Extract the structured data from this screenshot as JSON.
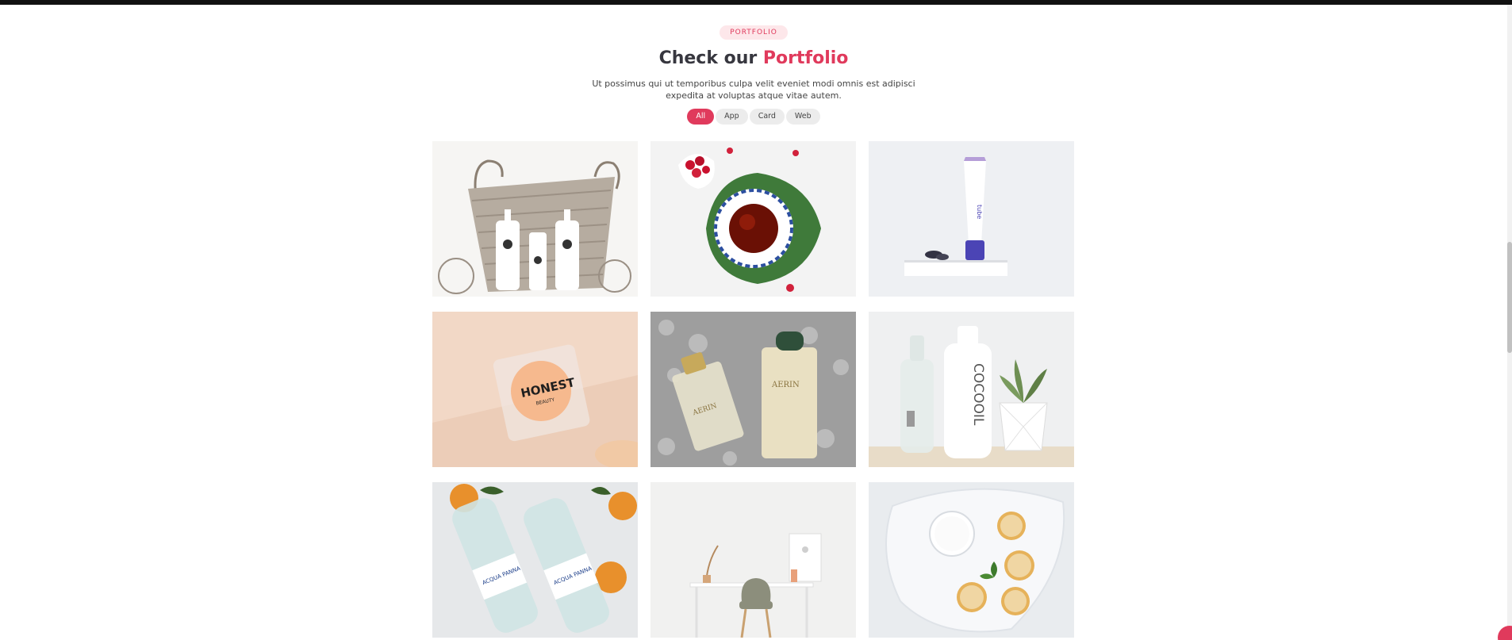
{
  "section": {
    "badge": "PORTFOLIO",
    "title_plain": "Check our",
    "title_accent": "Portfolio",
    "subtitle": "Ut possimus qui ut temporibus culpa velit eveniet modi omnis est adipisci expedita at voluptas atque vitae autem."
  },
  "filters": [
    {
      "label": "All",
      "active": true
    },
    {
      "label": "App",
      "active": false
    },
    {
      "label": "Card",
      "active": false
    },
    {
      "label": "Web",
      "active": false
    }
  ],
  "portfolio_items": [
    {
      "image": "basket-with-skincare-bottles"
    },
    {
      "image": "tea-cup-with-raspberries"
    },
    {
      "image": "cosmetic-tube-on-pedestal"
    },
    {
      "image": "honest-beauty-compact",
      "label_text": "HONEST",
      "label_sub": "BEAUTY"
    },
    {
      "image": "aerin-perfume-bottles",
      "label_text": "AERIN"
    },
    {
      "image": "cocooil-bottle-and-succulent",
      "label_text": "COCOOIL"
    },
    {
      "image": "acqua-panna-bottles-with-tangerines",
      "label_text": "ACQUA PANNA"
    },
    {
      "image": "desk-and-chair-interior"
    },
    {
      "image": "plate-with-cookies-and-cream"
    }
  ],
  "colors": {
    "accent": "#e03a5c",
    "badge_bg": "#fde7ea",
    "filter_bg": "#ececec",
    "topbar": "#111111"
  }
}
